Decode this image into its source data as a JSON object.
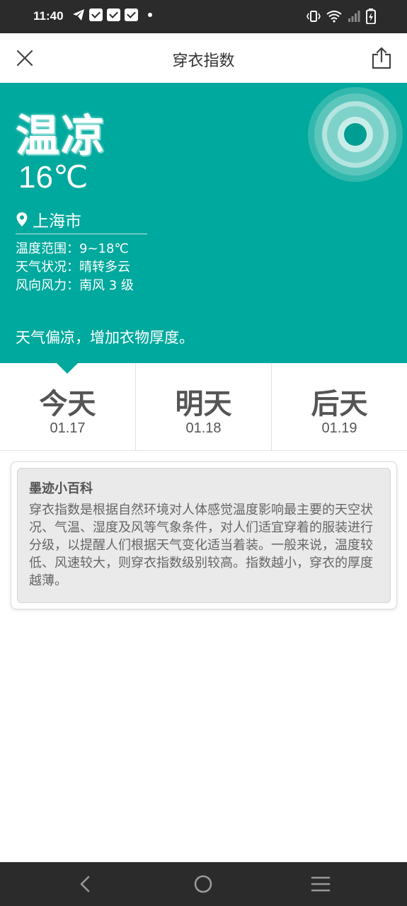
{
  "status_bar": {
    "time": "11:40",
    "icons": [
      "telegram-icon",
      "mail-icon",
      "mail-icon",
      "mail-icon",
      "dot-icon",
      "vibrate-icon",
      "wifi-icon",
      "signal-icon",
      "battery-icon"
    ]
  },
  "header": {
    "title": "穿衣指数",
    "close_icon": "close-icon",
    "share_icon": "share-icon"
  },
  "hero": {
    "level": "温凉",
    "temperature": "16℃",
    "location": "上海市",
    "details": [
      "温度范围：9~18℃",
      "天气状况：晴转多云",
      "风向风力：南风 3 级"
    ],
    "tip": "天气偏凉，增加衣物厚度。",
    "background_color": "#00a99d"
  },
  "days": [
    {
      "name": "今天",
      "date": "01.17",
      "selected": true
    },
    {
      "name": "明天",
      "date": "01.18",
      "selected": false
    },
    {
      "name": "后天",
      "date": "01.19",
      "selected": false
    }
  ],
  "info_card": {
    "title": "墨迹小百科",
    "text": "穿衣指数是根据自然环境对人体感觉温度影响最主要的天空状况、气温、湿度及风等气象条件，对人们适宜穿着的服装进行分级，以提醒人们根据天气变化适当着装。一般来说，温度较低、风速较大，则穿衣指数级别较高。指数越小，穿衣的厚度越薄。"
  },
  "nav_bar": {
    "buttons": [
      "back-icon",
      "home-icon",
      "menu-icon"
    ]
  }
}
